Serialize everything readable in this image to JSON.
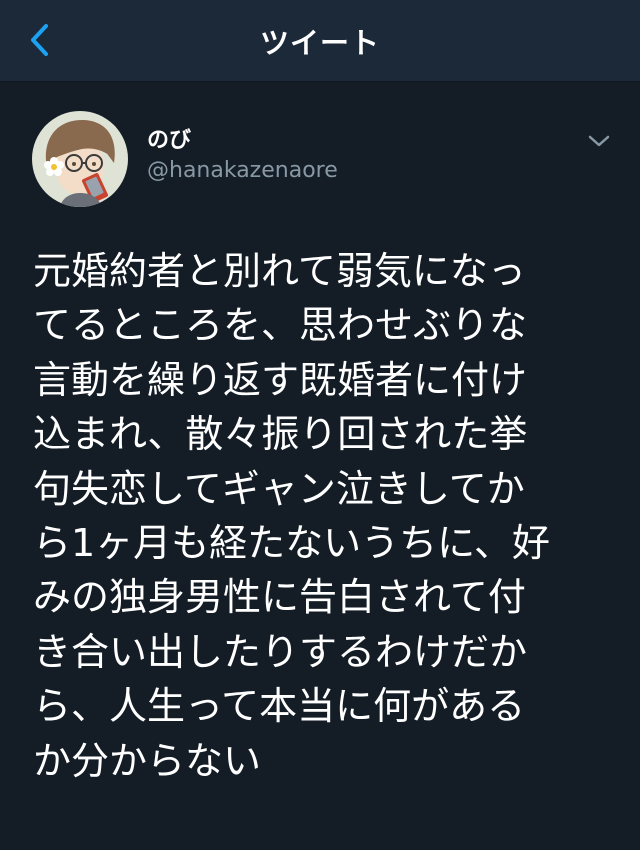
{
  "nav": {
    "back_icon": "chevron-left-icon",
    "title": "ツイート"
  },
  "tweet": {
    "avatar_icon": "avatar-illustration",
    "display_name": "のび",
    "handle": "@hanakazenaore",
    "menu_icon": "chevron-down-icon",
    "text": "元婚約者と別れて弱気になっ\nてるところを、思わせぶりな\n言動を繰り返す既婚者に付け\n込まれ、散々振り回された挙\n句失恋してギャン泣きしてか\nら1ヶ月も経たないうちに、好\nみの独身男性に告白されて付\nき合い出したりするわけだか\nら、人生って本当に何がある\nか分からない"
  },
  "colors": {
    "background": "#141d26",
    "nav_background": "#1c2938",
    "accent": "#1da1f2",
    "secondary_text": "#8899a6"
  }
}
